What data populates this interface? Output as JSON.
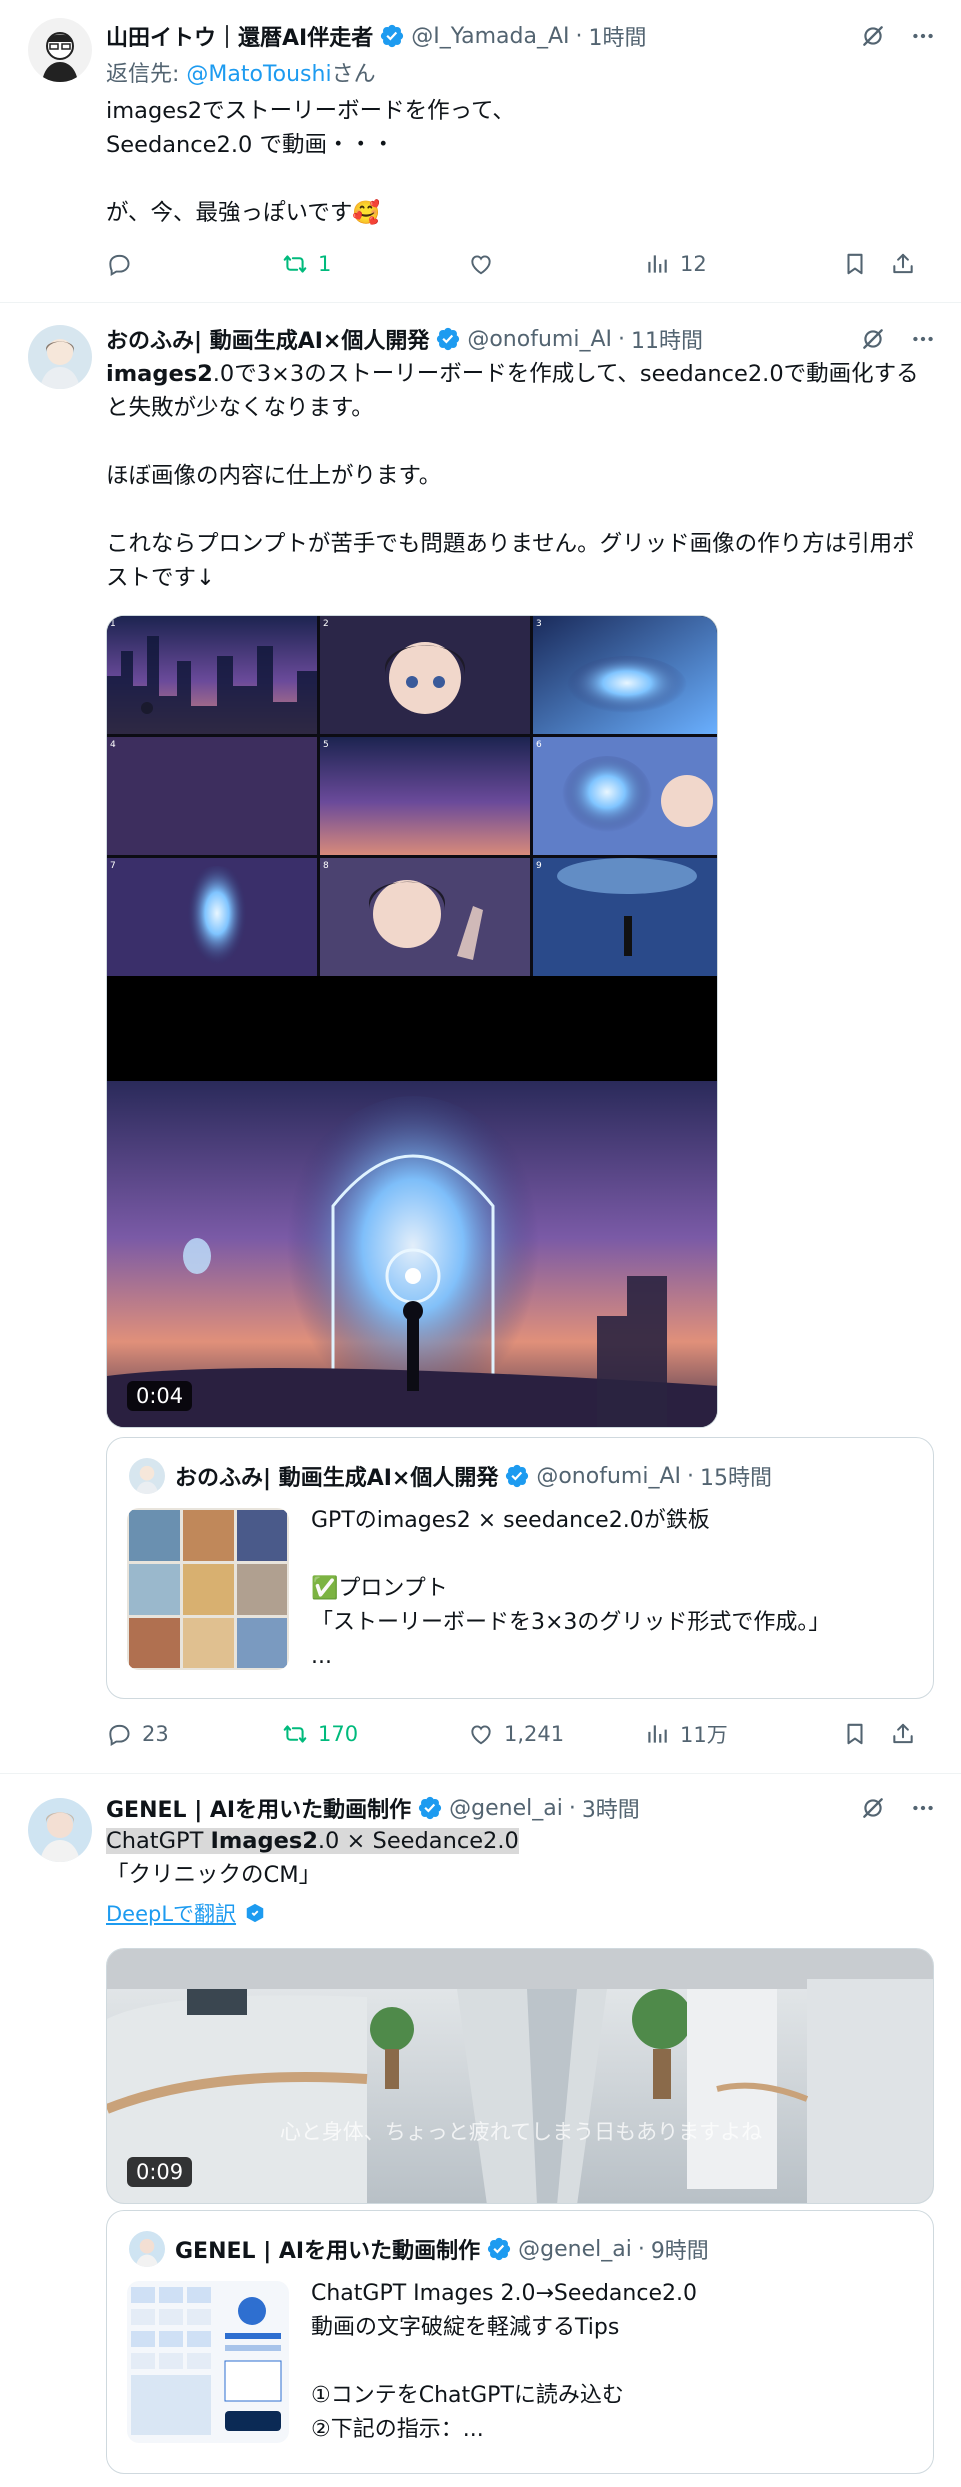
{
  "posts": [
    {
      "name": "山田イトウ｜還暦AI伴走者",
      "handle": "@I_Yamada_AI",
      "time": "1時間",
      "reply_prefix": "返信先: ",
      "reply_to": "@MatoToushi",
      "reply_suffix": "さん",
      "text": "images2でストーリーボードを作って、\nSeedance2.0 で動画・・・\n\nが、今、最強っぽいです🥰",
      "stats": {
        "replies": "",
        "reposts": "1",
        "likes": "",
        "views": "12"
      }
    },
    {
      "name": "おのふみ| 動画生成AI×個人開発",
      "handle": "@onofumi_AI",
      "time": "11時間",
      "text_bold": "images2",
      "text_rest": ".0で3×3のストーリーボードを作成して、seedance2.0で動画化すると失敗が少なくなります。\n\nほぼ画像の内容に仕上がります。\n\nこれならプロンプトが苦手でも問題ありません。グリッド画像の作り方は引用ポストです↓",
      "grid_numbers": [
        "1",
        "2",
        "3",
        "4",
        "5",
        "6",
        "7",
        "8",
        "9"
      ],
      "video_duration": "0:04",
      "quote": {
        "name": "おのふみ| 動画生成AI×個人開発",
        "handle": "@onofumi_AI",
        "time": "15時間",
        "text": "GPTのimages2 × seedance2.0が鉄板\n\n✅プロンプト\n「ストーリーボードを3×3のグリッド形式で作成。」\n..."
      },
      "stats": {
        "replies": "23",
        "reposts": "170",
        "likes": "1,241",
        "views": "11万"
      }
    },
    {
      "name": "GENEL | AIを用いた動画制作",
      "handle": "@genel_ai",
      "time": "3時間",
      "text_line1_a": "ChatGPT ",
      "text_line1_b": "Images2",
      "text_line1_c": ".0 × Seedance2.0",
      "text_line2": "「クリニックのCM」",
      "translate": "DeepLで翻訳",
      "video_duration": "0:09",
      "video_caption": "心と身体、ちょっと疲れてしまう日もありますよね",
      "quote": {
        "name": "GENEL | AIを用いた動画制作",
        "handle": "@genel_ai",
        "time": "9時間",
        "text": "ChatGPT Images 2.0→Seedance2.0\n動画の文字破綻を軽減するTips\n\n①コンテをChatGPTに読み込む\n②下記の指示：..."
      }
    }
  ],
  "colors": {
    "accent": "#1d9bf0",
    "repost": "#00ba7c",
    "muted": "#536471",
    "border": "#cfd9de"
  }
}
